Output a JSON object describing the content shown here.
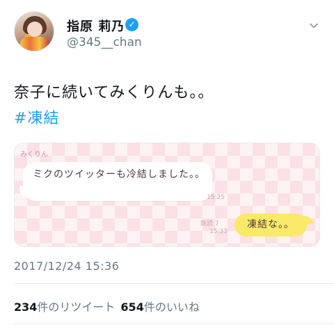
{
  "user": {
    "display_name": "指原 莉乃",
    "handle": "@345__chan",
    "verified_icon": "verified-check-icon"
  },
  "tweet": {
    "text": "奈子に続いてみくりんも。。",
    "hashtag": "#凍結",
    "timestamp": "2017/12/24 15:36"
  },
  "media": {
    "sender": "みくりん",
    "message_left": "ミクのツイッターも冷結しました。。",
    "time_left": "15:25",
    "read_label": "既読 7",
    "time_right": "15:33",
    "message_right": "凍結な。。"
  },
  "stats": {
    "retweet_count": "234",
    "retweet_label": "件のリツイート",
    "like_count": "654",
    "like_label": "件のいいね"
  },
  "colors": {
    "link": "#1da1f2",
    "secondary_text": "#657786",
    "bubble_right": "#fbe96a"
  }
}
